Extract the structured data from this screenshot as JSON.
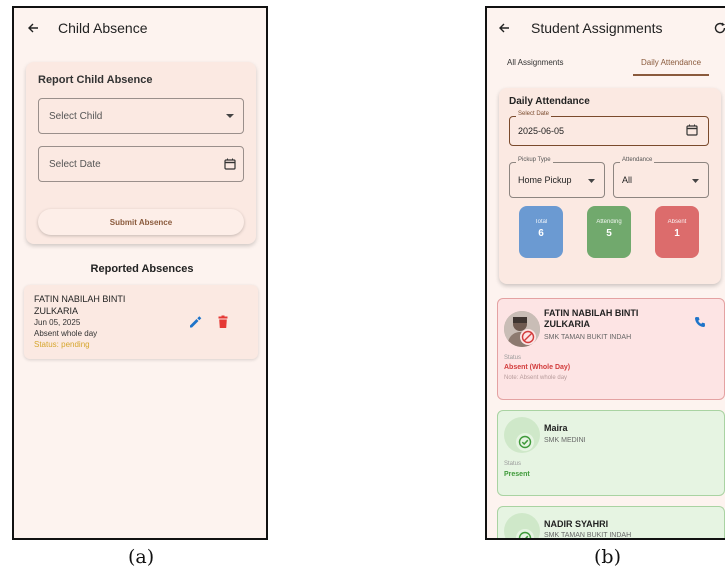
{
  "screen_a": {
    "title": "Child Absence",
    "form": {
      "title": "Report Child Absence",
      "child_placeholder": "Select Child",
      "date_placeholder": "Select Date",
      "submit_label": "Submit Absence"
    },
    "section_title": "Reported Absences",
    "absence": {
      "name_line1": "FATIN NABILAH BINTI",
      "name_line2": "ZULKARIA",
      "date": "Jun 05, 2025",
      "reason": "Absent whole day",
      "status": "Status: pending"
    }
  },
  "screen_b": {
    "title": "Student Assignments",
    "tabs": [
      "All Assignments",
      "Daily Attendance"
    ],
    "active_tab": "Daily Attendance",
    "card": {
      "title": "Daily Attendance",
      "date_label": "Select Date",
      "date_value": "2025-06-05",
      "pickup_label": "Pickup Type",
      "pickup_value": "Home Pickup",
      "attendance_label": "Attendance",
      "attendance_value": "All",
      "stats": [
        {
          "label": "Total",
          "value": "6",
          "color": "#6b9ad2"
        },
        {
          "label": "Attending",
          "value": "5",
          "color": "#71a96d"
        },
        {
          "label": "Absent",
          "value": "1",
          "color": "#dc6c6c"
        }
      ]
    },
    "students": [
      {
        "name_line1": "FATIN NABILAH BINTI",
        "name_line2": "ZULKARIA",
        "school": "SMK TAMAN BUKIT INDAH",
        "status_label": "Status",
        "status_value": "Absent (Whole Day)",
        "note": "Note: Absent whole day"
      },
      {
        "name": "Maira",
        "school": "SMK MEDINI",
        "status_label": "Status",
        "status_value": "Present"
      },
      {
        "name": "NADIR SYAHRI",
        "school": "SMK TAMAN BUKIT INDAH"
      }
    ]
  },
  "captions": [
    "(a)",
    "(b)"
  ],
  "colors": {
    "background": "#fdf3ef",
    "card": "#fbe9e2",
    "accent_brown": "#8a5a3c",
    "pending": "#d6a62e",
    "absent_red": "#d23c3c",
    "present_green": "#3f9a3a",
    "edit_blue": "#1e74c9",
    "delete_red": "#e53935"
  },
  "icons": [
    "back-arrow-icon",
    "dropdown-arrow-icon",
    "calendar-icon",
    "edit-pencil-icon",
    "delete-trash-icon",
    "refresh-icon",
    "phone-icon",
    "check-circle-icon",
    "absent-badge-icon"
  ]
}
